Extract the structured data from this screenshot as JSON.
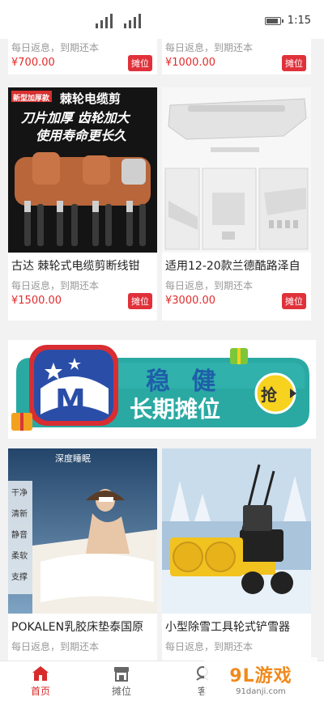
{
  "status_bar": {
    "time": "1:15"
  },
  "top_cards": [
    {
      "desc": "每日返息，到期还本",
      "price": "¥700.00",
      "badge": "摊位"
    },
    {
      "desc": "每日返息，到期还本",
      "price": "¥1000.00",
      "badge": "摊位"
    }
  ],
  "cards_row1": [
    {
      "image_text": [
        "新型加厚款",
        "棘轮电缆剪",
        "刀片加厚 齿轮加大",
        "使用寿命更长久"
      ],
      "title": "古达 棘轮式电缆剪断线钳",
      "desc": "每日返息，到期还本",
      "price": "¥1500.00",
      "badge": "摊位"
    },
    {
      "title": "适用12-20款兰德酷路泽自",
      "desc": "每日返息，到期还本",
      "price": "¥3000.00",
      "badge": "摊位"
    }
  ],
  "banner": {
    "line1": "稳 健",
    "line2": "长期摊位",
    "button": "抢"
  },
  "cards_row2": [
    {
      "image_text": [
        "深度睡眠",
        "干净",
        "清新",
        "静音",
        "柔软",
        "支撑"
      ],
      "title": "POKALEN乳胶床垫泰国原",
      "desc": "每日返息，到期还本"
    },
    {
      "title": "小型除雪工具轮式铲雪器",
      "desc": "每日返息，到期还本"
    }
  ],
  "tabbar": {
    "items": [
      {
        "label": "首页",
        "icon": "home-icon"
      },
      {
        "label": "摊位",
        "icon": "stall-icon"
      },
      {
        "label": "客",
        "icon": "service-icon"
      },
      {
        "label": "",
        "icon": ""
      }
    ]
  },
  "watermark": {
    "logo": "9L游戏",
    "url": "91danji.com"
  },
  "colors": {
    "accent": "#e0313a",
    "price": "#e32b2b",
    "banner_teal": "#27a9a4"
  }
}
